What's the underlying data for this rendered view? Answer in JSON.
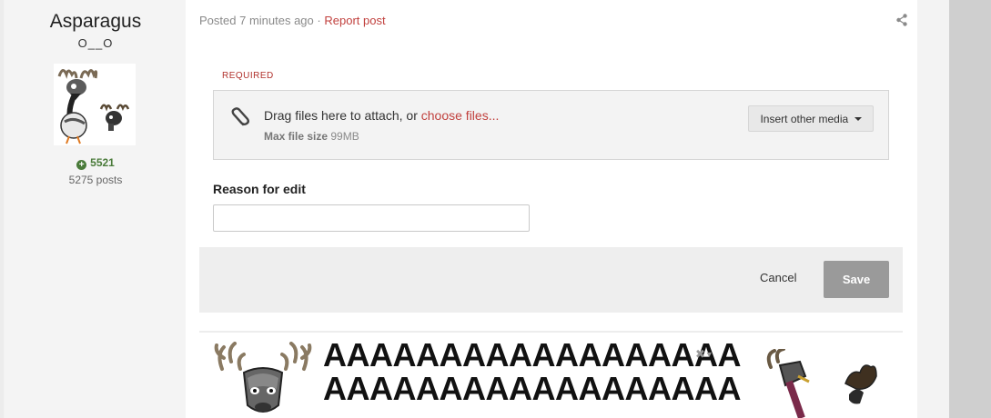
{
  "author": {
    "name": "Asparagus",
    "title": "O__O",
    "reputation": "5521",
    "posts": "5275 posts"
  },
  "post": {
    "posted_prefix": "Posted",
    "posted_time": "7 minutes ago",
    "separator": "·",
    "report_link": "Report post"
  },
  "editor": {
    "required_label": "REQUIRED",
    "attach_text": "Drag files here to attach, or ",
    "choose_files": "choose files...",
    "max_size_label": "Max file size",
    "max_size_value": "99MB",
    "insert_media_label": "Insert other media"
  },
  "reason": {
    "label": "Reason for edit",
    "value": "",
    "placeholder": ""
  },
  "actions": {
    "cancel_label": "Cancel",
    "save_label": "Save"
  },
  "signature": {
    "line1": "AAAAAAAAAAAAAAAAAA",
    "line2": "AAAAAAAAAAAAAAAAAA"
  },
  "colors": {
    "accent_link": "#c1413e",
    "reputation_green": "#4a7b3a",
    "save_button_disabled": "#9a9a9a"
  },
  "icons": {
    "share": "share-icon",
    "attach": "paperclip-icon",
    "reputation": "plus-circle-icon",
    "signature_options": "close-icon"
  }
}
